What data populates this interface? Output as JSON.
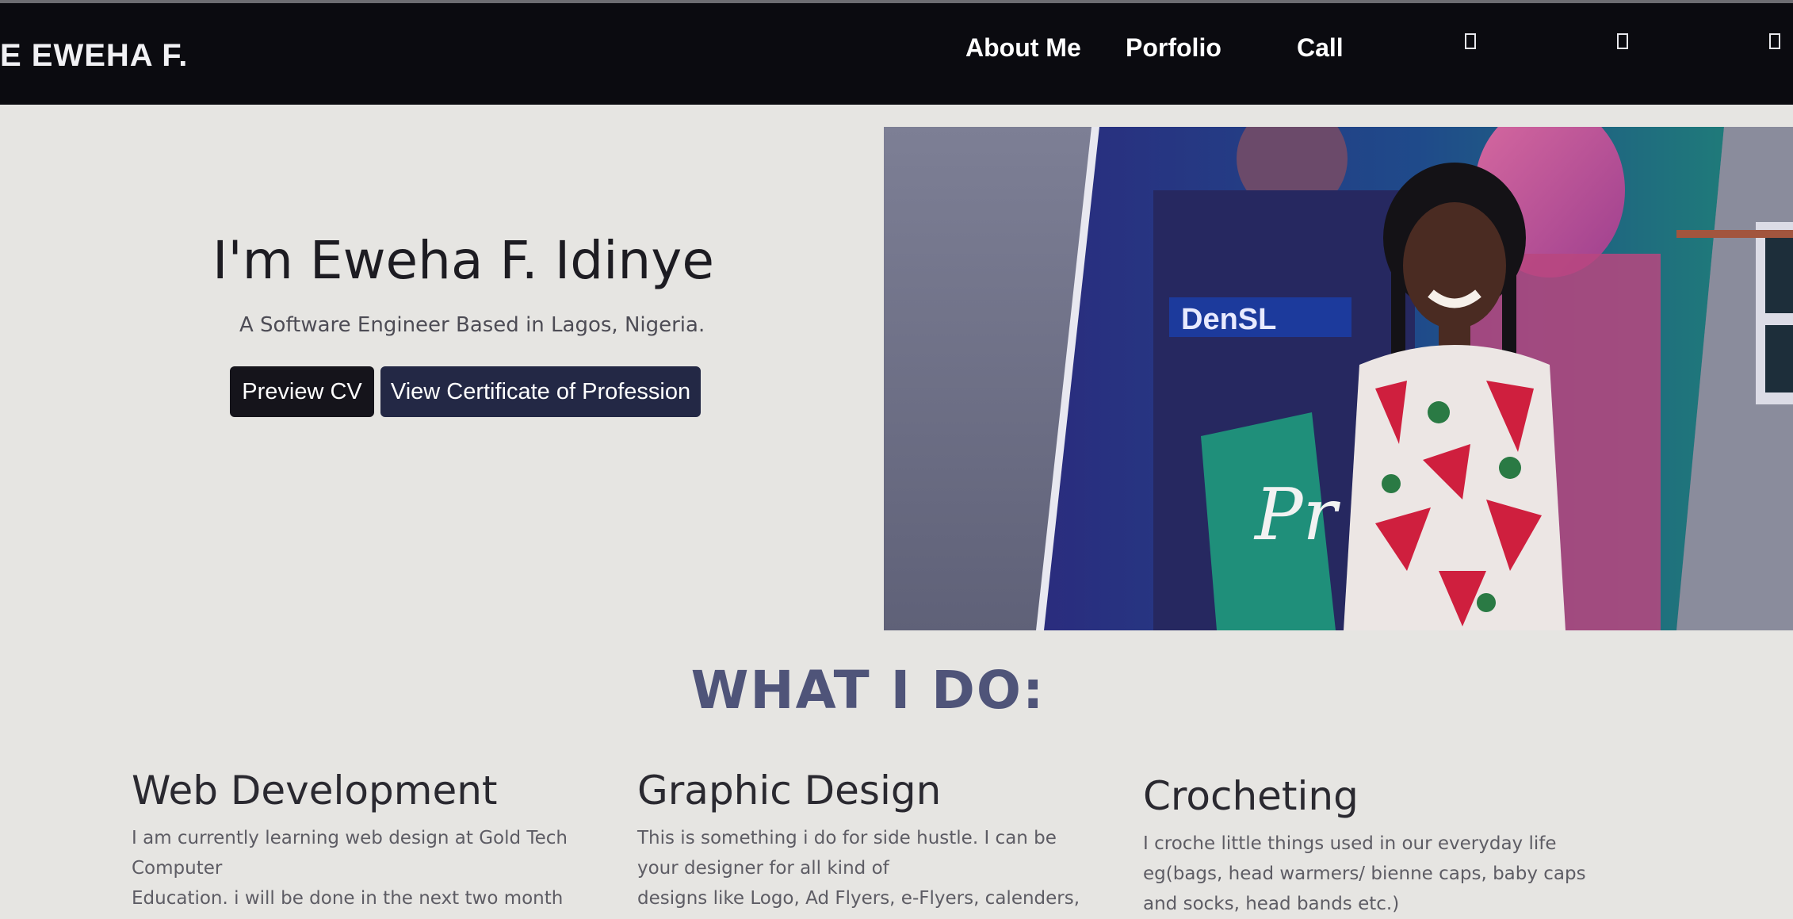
{
  "nav": {
    "brand": "E EWEHA F.",
    "links": [
      "About Me",
      "Porfolio",
      "Call"
    ],
    "icon_names": [
      "square-icon",
      "square-icon",
      "square-icon"
    ]
  },
  "hero": {
    "title": "I'm Eweha F. Idinye",
    "subtitle": "A Software Engineer Based in Lagos, Nigeria.",
    "buttons": {
      "preview_cv": "Preview CV",
      "certificate": "View Certificate of Profession"
    }
  },
  "section": {
    "title": "WHAT I DO:"
  },
  "services": [
    {
      "title": "Web Development",
      "lines": [
        "I am currently learning web design at Gold Tech",
        "Computer",
        "Education. i will be done in the next two month"
      ]
    },
    {
      "title": "Graphic Design",
      "lines": [
        "This is something i do for side hustle. I can be",
        "your designer for all kind of",
        "designs like Logo, Ad Flyers, e-Flyers, calenders,"
      ]
    },
    {
      "title": "Crocheting",
      "lines": [
        "I croche little things used in our everyday life",
        "eg(bags, head warmers/ bienne caps, baby caps",
        "and socks, head bands etc.)"
      ]
    }
  ],
  "colors": {
    "navbar": "#0b0b10",
    "page_bg": "#e6e5e2",
    "btn_cv": "#15141b",
    "btn_cert": "#232845",
    "section_title": "#4f5479"
  }
}
